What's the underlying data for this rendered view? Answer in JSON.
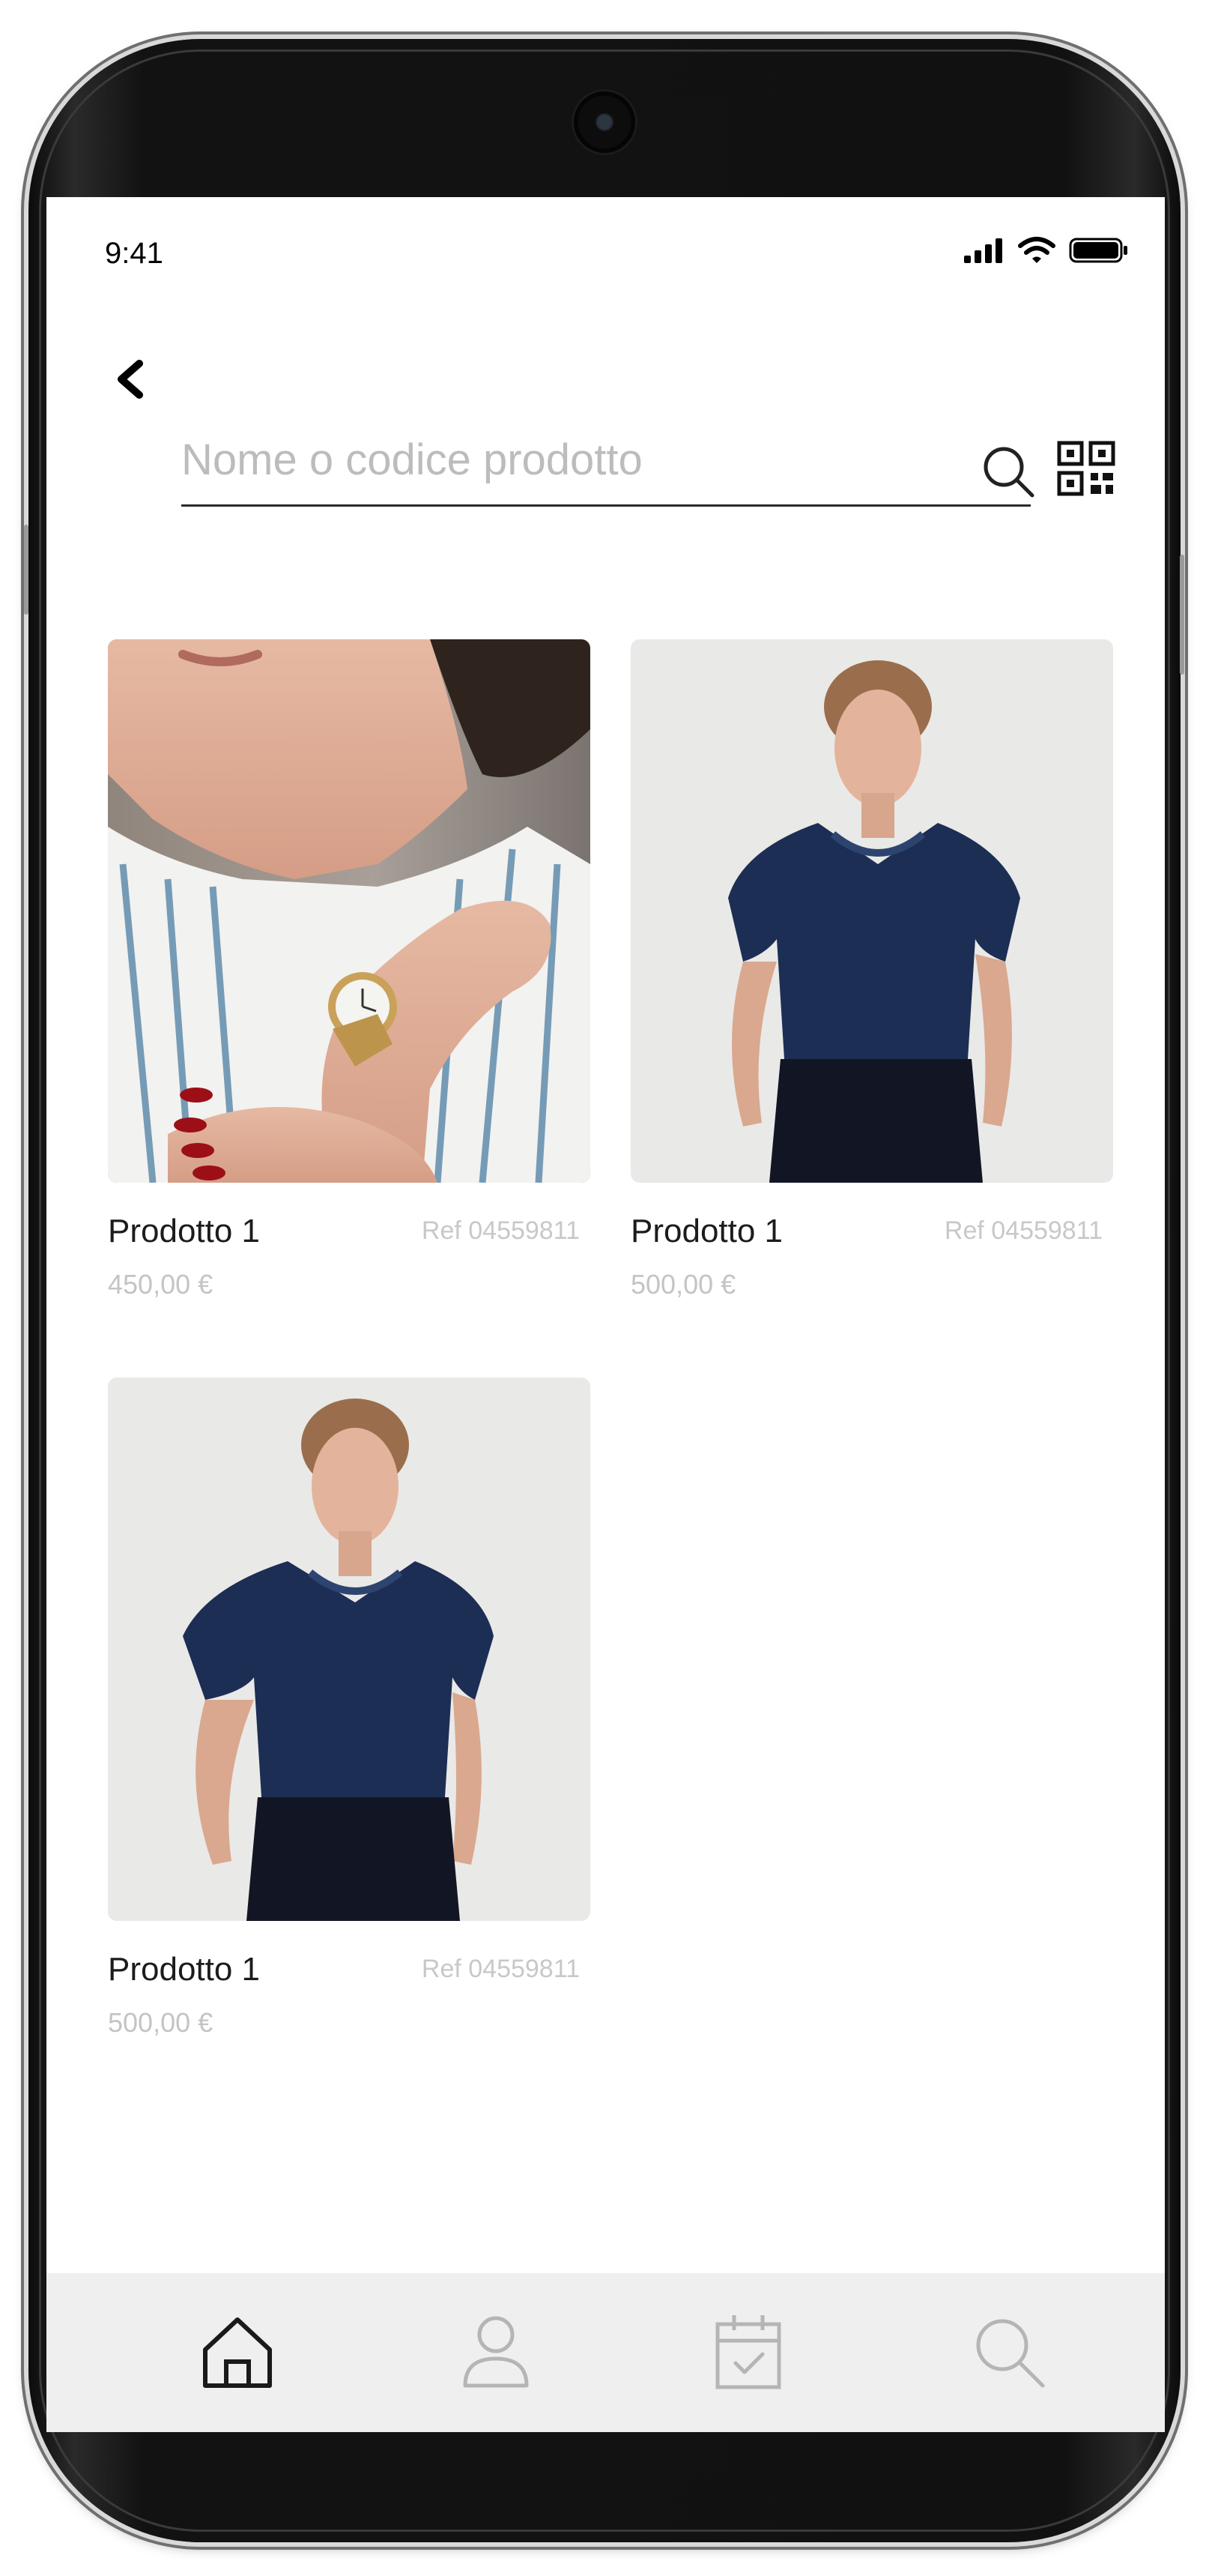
{
  "status_bar": {
    "time": "9:41",
    "signal_icon": "cellular-signal-icon",
    "wifi_icon": "wifi-icon",
    "battery_icon": "battery-icon"
  },
  "header": {
    "back_icon": "chevron-left-icon",
    "search": {
      "placeholder": "Nome o codice prodotto",
      "value": ""
    },
    "search_icon": "search-icon",
    "qr_icon": "qr-code-icon"
  },
  "products": [
    {
      "name": "Prodotto 1",
      "ref": "Ref 04559811",
      "price": "450,00 €",
      "image": "woman-wearing-gold-watch-striped-shirt"
    },
    {
      "name": "Prodotto 1",
      "ref": "Ref 04559811",
      "price": "500,00 €",
      "image": "woman-in-navy-satin-blouse"
    },
    {
      "name": "Prodotto 1",
      "ref": "Ref 04559811",
      "price": "500,00 €",
      "image": "woman-in-navy-satin-blouse"
    }
  ],
  "tabbar": {
    "items": [
      {
        "icon": "home-icon",
        "active": true
      },
      {
        "icon": "user-icon",
        "active": false
      },
      {
        "icon": "calendar-check-icon",
        "active": false
      },
      {
        "icon": "search-icon",
        "active": false
      }
    ]
  },
  "colors": {
    "active_icon": "#1a1a1a",
    "inactive_icon": "#b5b5b5",
    "tabbar_bg": "#efefef",
    "placeholder": "#bcbcbc"
  }
}
